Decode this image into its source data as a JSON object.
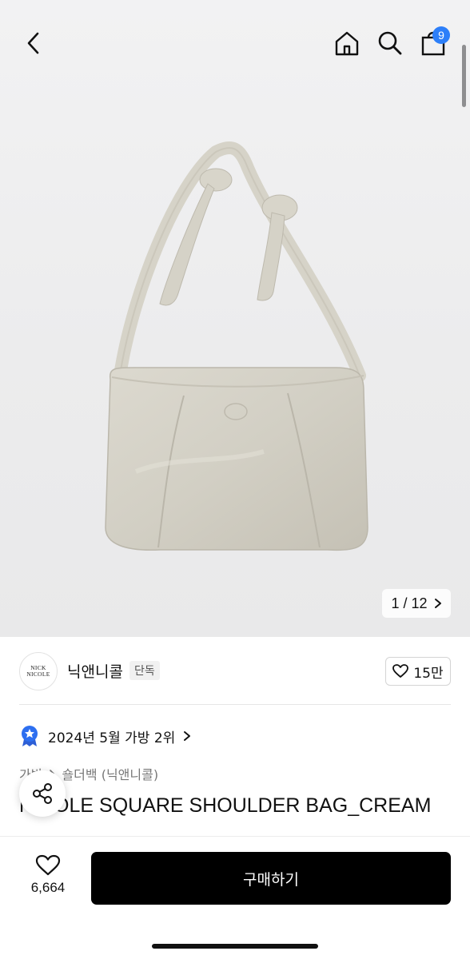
{
  "header": {
    "cart_count": "9",
    "icons": [
      "chevron-left-icon",
      "home-icon",
      "search-icon",
      "shopping-bag-icon"
    ]
  },
  "gallery": {
    "counter": "1 / 12"
  },
  "brand": {
    "logo_line1": "NICK",
    "logo_line2": "NICOLE",
    "name": "닉앤니콜",
    "exclusive_badge": "단독",
    "like_count": "15만"
  },
  "ranking": {
    "text": "2024년 5월 가방 2위"
  },
  "breadcrumb": {
    "category": "가방",
    "subcategory": "숄더백 (닉앤니콜)"
  },
  "product": {
    "title": "NICOLE SQUARE SHOULDER BAG_CREAM"
  },
  "bottom_bar": {
    "wish_count": "6,664",
    "buy_label": "구매하기"
  },
  "colors": {
    "accent_blue": "#2d7ff9",
    "buy_button": "#000000"
  }
}
